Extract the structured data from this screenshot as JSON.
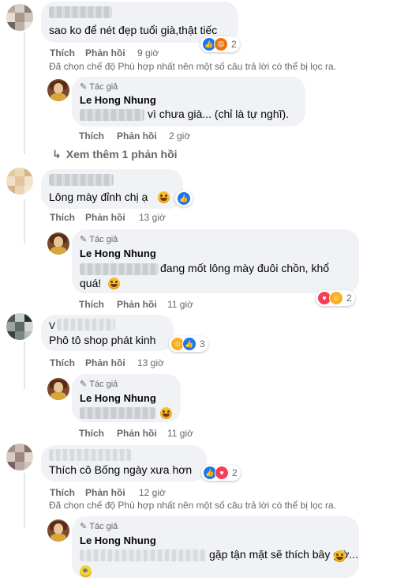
{
  "comments": [
    {
      "id": "c1",
      "text": "sao ko để nét đẹp tuổi già,thật tiếc",
      "like": "Thích",
      "reply": "Phản hồi",
      "time": "9 giờ",
      "reactions": [
        "like",
        "angry"
      ],
      "reaction_count": "2",
      "filter_note": "Đã chọn chế độ Phù hợp nhất nên một số câu trả lời có thể bị lọc ra."
    },
    {
      "id": "r1",
      "tag": "Tác giả",
      "name": "Le Hong Nhung",
      "text": "vì chưa già... (chỉ là tự nghĩ).",
      "like": "Thích",
      "reply": "Phản hồi",
      "time": "2 giờ"
    },
    {
      "id": "more",
      "text": "Xem thêm 1 phản hồi"
    },
    {
      "id": "c2",
      "text": "Lông mày đỉnh chị ạ",
      "like": "Thích",
      "reply": "Phản hồi",
      "time": "13 giờ",
      "reactions": [
        "like"
      ]
    },
    {
      "id": "r2",
      "tag": "Tác giả",
      "name": "Le Hong Nhung",
      "text1": "đang mốt lông mày đuôi chồn, khổ",
      "text2": "quá!",
      "like": "Thích",
      "reply": "Phản hồi",
      "time": "11 giờ",
      "reactions": [
        "love",
        "haha"
      ],
      "reaction_count": "2"
    },
    {
      "id": "c3",
      "name_visible": "V",
      "text": "Phô tô shop phát kinh",
      "like": "Thích",
      "reply": "Phản hồi",
      "time": "13 giờ",
      "reactions": [
        "haha",
        "like"
      ],
      "reaction_count": "3"
    },
    {
      "id": "r3",
      "tag": "Tác giả",
      "name": "Le Hong Nhung",
      "like": "Thích",
      "reply": "Phản hồi",
      "time": "11 giờ"
    },
    {
      "id": "c4",
      "text": "Thích cô Bống ngày xưa hơn",
      "like": "Thích",
      "reply": "Phản hồi",
      "time": "12 giờ",
      "reactions": [
        "like",
        "love"
      ],
      "reaction_count": "2",
      "filter_note": "Đã chọn chế độ Phù hợp nhất nên một số câu trả lời có thể bị lọc ra."
    },
    {
      "id": "r4",
      "tag": "Tác giả",
      "name": "Le Hong Nhung",
      "text": "gặp tận mặt sẽ thích bây giờ..."
    }
  ],
  "colors": {
    "bubble": "#f0f2f5",
    "secondary_text": "#65676b",
    "like_blue": "#1877f2",
    "love_red": "#f33e58",
    "haha_yellow": "#f7b125"
  }
}
